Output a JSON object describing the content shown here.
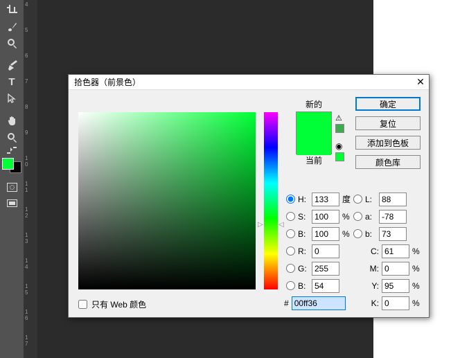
{
  "dialog": {
    "title": "拾色器（前景色）",
    "new_label": "新的",
    "current_label": "当前",
    "buttons": {
      "ok": "确定",
      "reset": "复位",
      "add": "添加到色板",
      "lib": "颜色库"
    },
    "hsb": {
      "h_label": "H:",
      "h_value": "133",
      "h_unit": "度",
      "s_label": "S:",
      "s_value": "100",
      "s_unit": "%",
      "b_label": "B:",
      "b_value": "100",
      "b_unit": "%"
    },
    "lab": {
      "l_label": "L:",
      "l_value": "88",
      "a_label": "a:",
      "a_value": "-78",
      "b_label": "b:",
      "b_value": "73"
    },
    "rgb": {
      "r_label": "R:",
      "r_value": "0",
      "g_label": "G:",
      "g_value": "255",
      "b_label": "B:",
      "b_value": "54"
    },
    "cmyk": {
      "c_label": "C:",
      "c_value": "61",
      "m_label": "M:",
      "m_value": "0",
      "y_label": "Y:",
      "y_value": "95",
      "k_label": "K:",
      "k_value": "0",
      "unit": "%"
    },
    "web_only": "只有 Web 颜色",
    "hex_prefix": "#",
    "hex_value": "00ff36",
    "colors": {
      "new": "#00ff36",
      "current": "#00ff36",
      "warn_sq": "#3faa4e",
      "cube_sq": "#00ff33",
      "fg": "#00ff36"
    }
  },
  "ruler": {
    "marks": [
      "4",
      "5",
      "6",
      "7",
      "8",
      "9",
      "10",
      "11",
      "12",
      "13",
      "14",
      "15",
      "16",
      "17"
    ]
  }
}
